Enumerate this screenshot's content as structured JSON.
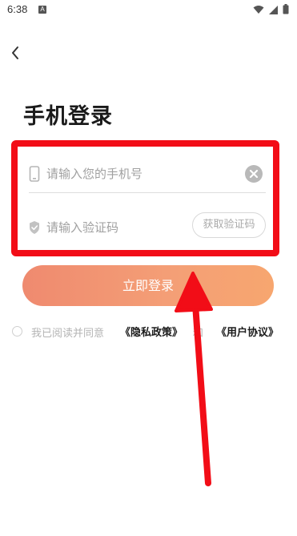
{
  "status_bar": {
    "time": "6:38",
    "notification_icon": "A"
  },
  "nav": {
    "back_icon": "chevron-left-icon"
  },
  "page": {
    "title": "手机登录"
  },
  "phone_field": {
    "placeholder": "请输入您的手机号",
    "value": "",
    "icon": "phone-icon"
  },
  "code_field": {
    "placeholder": "请输入验证码",
    "value": "",
    "icon": "shield-icon",
    "button_label": "获取验证码"
  },
  "login_button": {
    "label": "立即登录"
  },
  "agreement": {
    "text": "我已阅读并同意",
    "privacy_link": "《隐私政策》",
    "conjunction": "和",
    "terms_link": "《用户协议》"
  },
  "colors": {
    "accent_start": "#ef8a6f",
    "accent_end": "#f7a66f",
    "highlight": "#f20d17"
  }
}
